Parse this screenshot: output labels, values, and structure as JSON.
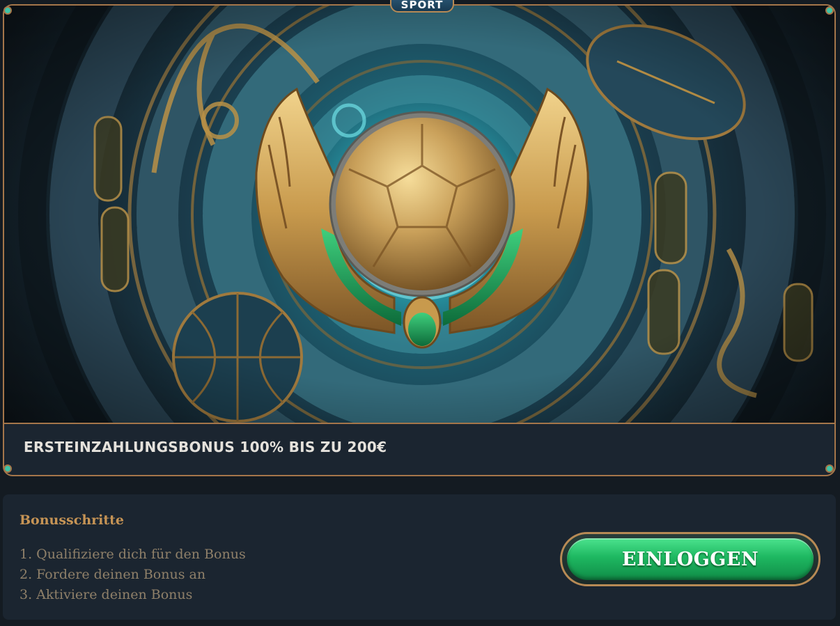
{
  "promo": {
    "tag": "SPORT",
    "title": "ERSTEINZAHLUNGSBONUS 100% BIS ZU 200€"
  },
  "bonus": {
    "heading": "Bonusschritte",
    "steps": [
      "1. Qualifiziere dich für den Bonus",
      "2. Fordere deinen Bonus an",
      "3. Aktiviere deinen Bonus"
    ],
    "login_label": "EINLOGGEN"
  },
  "colors": {
    "accent_gold": "#c69455",
    "border_bronze": "#a5764a",
    "button_green": "#1eb861",
    "panel_bg": "#1b2530",
    "page_bg": "#141b22"
  }
}
